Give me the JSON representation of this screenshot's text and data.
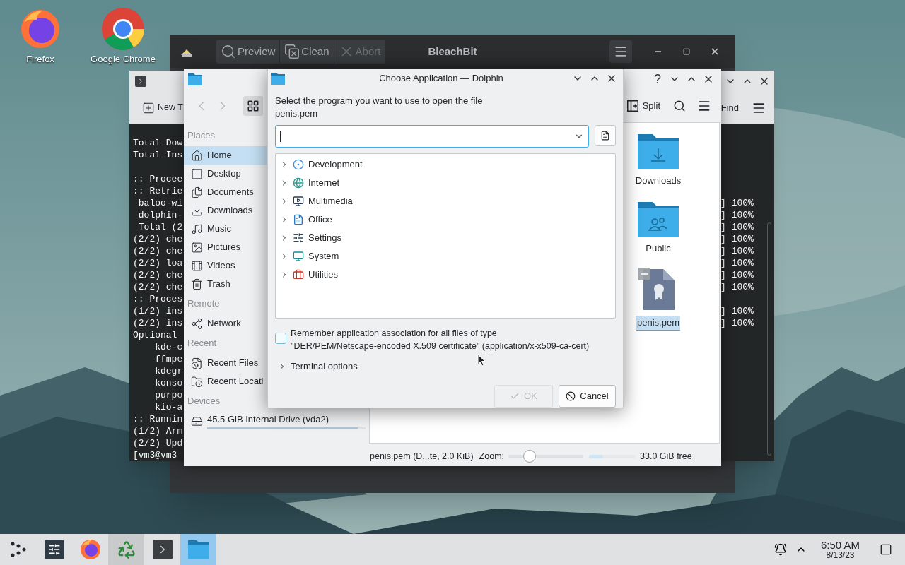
{
  "desktop_icons": [
    {
      "label": "Firefox",
      "kind": "firefox"
    },
    {
      "label": "Google Chrome",
      "kind": "chrome"
    }
  ],
  "bleachbit": {
    "title": "BleachBit",
    "toolbar": [
      {
        "label": "Preview",
        "kind": "preview",
        "disabled": false
      },
      {
        "label": "Clean",
        "kind": "clean",
        "disabled": false
      },
      {
        "label": "Abort",
        "kind": "abort",
        "disabled": true
      }
    ]
  },
  "konsole": {
    "new_tab": "New T",
    "find": "Find",
    "line_groups": [
      {
        "lines": [
          {
            "text": "Total Dow"
          },
          {
            "text": "Total Ins"
          }
        ]
      },
      {
        "lines": [
          {
            "text": ":: Procee"
          },
          {
            "text": ":: Retrie"
          },
          {
            "text": " baloo-wi",
            "tail": "] 100%"
          },
          {
            "text": " dolphin-",
            "tail": "] 100%"
          },
          {
            "text": " Total (2",
            "tail": "] 100%"
          },
          {
            "text": "(2/2) che",
            "tail": "] 100%"
          },
          {
            "text": "(2/2) che",
            "tail": "] 100%"
          },
          {
            "text": "(2/2) loa",
            "tail": "] 100%"
          },
          {
            "text": "(2/2) che",
            "tail": "] 100%"
          },
          {
            "text": "(2/2) che",
            "tail": "] 100%"
          },
          {
            "text": ":: Proces"
          },
          {
            "text": "(1/2) ins",
            "tail": "] 100%"
          },
          {
            "text": "(2/2) ins",
            "tail": "] 100%"
          },
          {
            "text": "Optional "
          },
          {
            "text": "    kde-c"
          },
          {
            "text": "    ffmpe"
          },
          {
            "text": "    kdegr"
          },
          {
            "text": "    konso"
          },
          {
            "text": "    purpo"
          },
          {
            "text": "    kio-a"
          },
          {
            "text": ":: Runnin"
          },
          {
            "text": "(1/2) Arm"
          },
          {
            "text": "(2/2) Upd"
          },
          {
            "text": "[vm3@vm3"
          }
        ]
      }
    ]
  },
  "dolphin": {
    "help": "?",
    "split": "Split",
    "sidebar": [
      {
        "heading": "Places",
        "items": [
          {
            "label": "Home",
            "kind": "home",
            "selected": true
          },
          {
            "label": "Desktop",
            "kind": "desktop",
            "selected": false
          },
          {
            "label": "Documents",
            "kind": "documents",
            "selected": false
          },
          {
            "label": "Downloads",
            "kind": "downloads",
            "selected": false
          },
          {
            "label": "Music",
            "kind": "music",
            "selected": false
          },
          {
            "label": "Pictures",
            "kind": "pictures",
            "selected": false
          },
          {
            "label": "Videos",
            "kind": "videos",
            "selected": false
          },
          {
            "label": "Trash",
            "kind": "trash",
            "selected": false
          }
        ]
      },
      {
        "heading": "Remote",
        "items": [
          {
            "label": "Network",
            "kind": "network",
            "selected": false
          }
        ]
      },
      {
        "heading": "Recent",
        "items": [
          {
            "label": "Recent Files",
            "kind": "recent-files",
            "selected": false
          },
          {
            "label": "Recent Locati",
            "kind": "recent-locations",
            "selected": false
          }
        ]
      },
      {
        "heading": "Devices",
        "items": [
          {
            "label": "45.5 GiB Internal Drive (vda2)",
            "kind": "drive",
            "selected": false,
            "level": 0.95
          }
        ]
      }
    ],
    "files": [
      {
        "name": "Downloads",
        "kind": "downloads-folder",
        "selected": false
      },
      {
        "name": "Public",
        "kind": "public-folder",
        "selected": false
      },
      {
        "name": "penis.pem",
        "kind": "certificate",
        "selected": true
      }
    ],
    "status": {
      "file_info": "penis.pem (D...te, 2.0 KiB)",
      "zoom_label": "Zoom:",
      "zoom": {
        "level": 0.28
      },
      "free_space": {
        "level": 0.3
      },
      "free": "33.0 GiB free"
    }
  },
  "dialog": {
    "title": "Choose Application — Dolphin",
    "prompt": "Select the program you want to use to open the file",
    "file_name": "penis.pem",
    "categories": [
      {
        "label": "Development",
        "kind": "development",
        "expanded": false
      },
      {
        "label": "Internet",
        "kind": "internet",
        "expanded": false
      },
      {
        "label": "Multimedia",
        "kind": "multimedia",
        "expanded": false
      },
      {
        "label": "Office",
        "kind": "office",
        "expanded": false
      },
      {
        "label": "Settings",
        "kind": "settings",
        "expanded": false
      },
      {
        "label": "System",
        "kind": "system",
        "expanded": false
      },
      {
        "label": "Utilities",
        "kind": "utilities",
        "expanded": false
      }
    ],
    "remember": {
      "label": "Remember application association for all files of type\n\"DER/PEM/Netscape-encoded X.509 certificate\" (application/x-x509-ca-cert)",
      "checked": false
    },
    "terminal_options": {
      "label": "Terminal options",
      "expanded": false
    },
    "buttons": [
      {
        "label": "OK",
        "kind": "ok",
        "disabled": true
      },
      {
        "label": "Cancel",
        "kind": "cancel",
        "disabled": false
      }
    ]
  },
  "taskbar": {
    "tasks": [
      {
        "kind": "launcher",
        "selected": false,
        "highlighted": false
      },
      {
        "kind": "settings",
        "selected": false,
        "highlighted": false
      },
      {
        "kind": "firefox",
        "selected": false,
        "highlighted": false
      },
      {
        "kind": "bleachbit",
        "selected": false,
        "highlighted": true
      },
      {
        "kind": "konsole",
        "selected": false,
        "highlighted": false
      },
      {
        "kind": "dolphin",
        "selected": true,
        "highlighted": false
      }
    ],
    "time": "6:50 AM",
    "date": "8/13/23"
  }
}
